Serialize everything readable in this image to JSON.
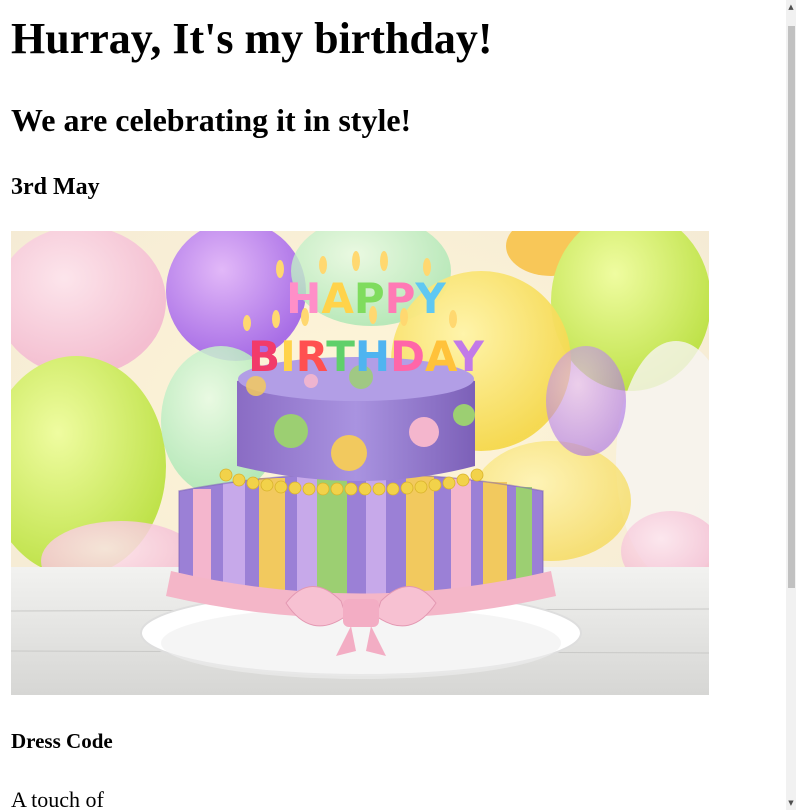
{
  "heading_main": "Hurray, It's my birthday!",
  "heading_sub": "We are celebrating it in style!",
  "date": "3rd May",
  "image": {
    "alt": "Birthday cake with candles",
    "candle_text_top": "HAPPY",
    "candle_text_bottom": "BIRTHDAY"
  },
  "dress_code_heading": "Dress Code",
  "dress_code_text": "A touch of",
  "colors": {
    "cake_purple": "#9b7fd1",
    "stripe_yellow": "#f2c95e",
    "stripe_green": "#9ccf72",
    "bow_pink": "#f4b6c8",
    "scrollbar_thumb": "#c1c1c1"
  },
  "icons": {
    "scroll_up": "scroll-up-arrow-icon",
    "scroll_down": "scroll-down-arrow-icon"
  }
}
